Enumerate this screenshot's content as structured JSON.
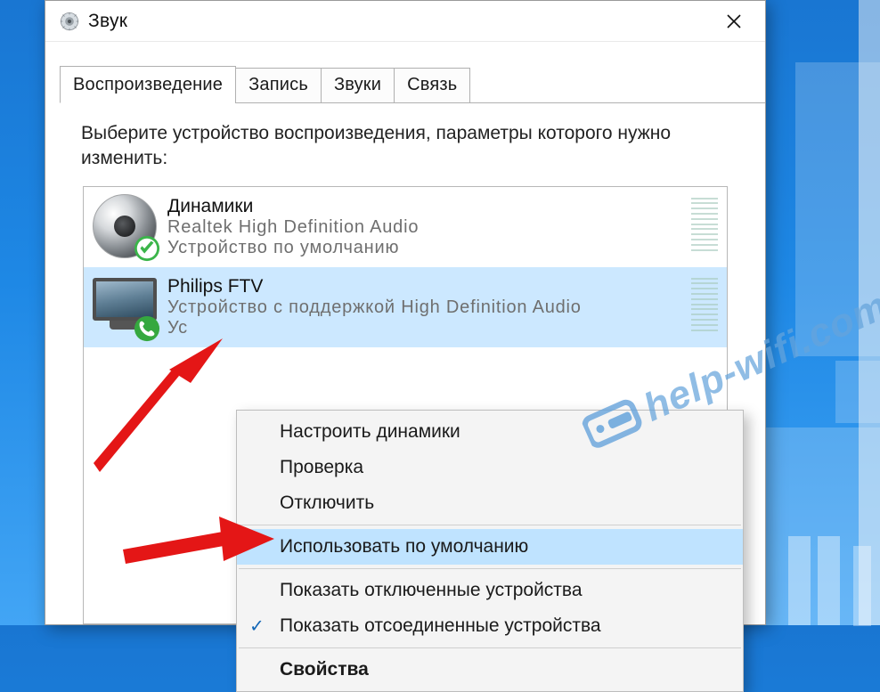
{
  "window": {
    "title": "Звук"
  },
  "tabs": {
    "playback": "Воспроизведение",
    "record": "Запись",
    "sounds": "Звуки",
    "comm": "Связь"
  },
  "instruction": "Выберите устройство воспроизведения, параметры которого нужно изменить:",
  "devices": [
    {
      "name": "Динамики",
      "driver": "Realtek High Definition Audio",
      "status": "Устройство по умолчанию",
      "icon": "speaker",
      "badge": "default-check",
      "selected": false
    },
    {
      "name": "Philips FTV",
      "driver": "Устройство с поддержкой High Definition Audio",
      "status": "Ус",
      "icon": "monitor",
      "badge": "comm-phone",
      "selected": true
    }
  ],
  "context_menu": {
    "configure": "Настроить динамики",
    "test": "Проверка",
    "disable": "Отключить",
    "set_default": "Использовать по умолчанию",
    "show_disabled": "Показать отключенные устройства",
    "show_disconnected": "Показать отсоединенные устройства",
    "properties": "Свойства",
    "show_disconnected_checked": true
  },
  "watermark": "help-wifi.com"
}
